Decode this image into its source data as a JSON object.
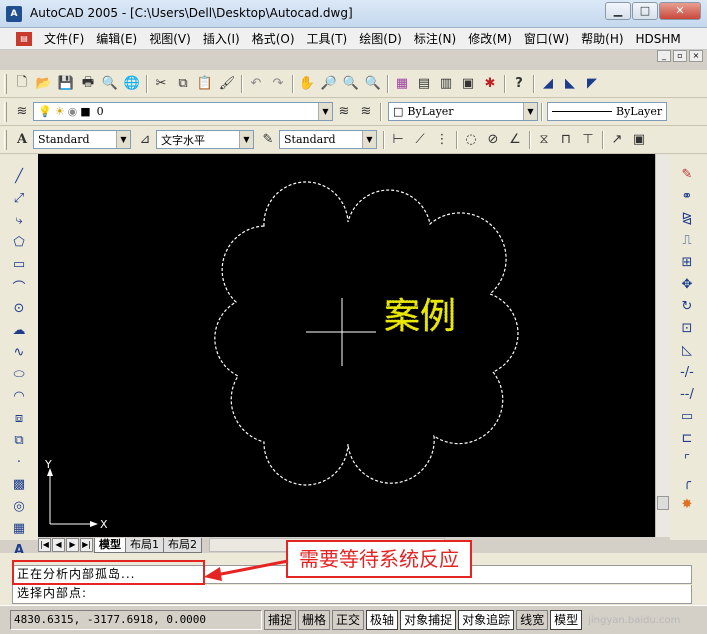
{
  "window": {
    "title": "AutoCAD 2005 - [C:\\Users\\Dell\\Desktop\\Autocad.dwg]",
    "minimize": "▁",
    "maximize": "□",
    "close": "✕"
  },
  "menu": {
    "items": [
      "文件(F)",
      "编辑(E)",
      "视图(V)",
      "插入(I)",
      "格式(O)",
      "工具(T)",
      "绘图(D)",
      "标注(N)",
      "修改(M)",
      "窗口(W)",
      "帮助(H)",
      "HDSHM"
    ]
  },
  "layer_toolbar": {
    "layer_value": "0",
    "color_value": "ByLayer",
    "linetype_value": "ByLayer"
  },
  "styles_toolbar": {
    "text_style": "Standard",
    "text_align": "文字水平",
    "dim_style": "Standard"
  },
  "drawing": {
    "text": "案例",
    "text_color": "#e8e800",
    "ucs_x_label": "X",
    "ucs_y_label": "Y"
  },
  "tabs": {
    "items": [
      "模型",
      "布局1",
      "布局2"
    ],
    "active": "模型"
  },
  "command": {
    "line1": "正在分析内部孤岛...",
    "line2": "选择内部点:"
  },
  "callout": {
    "text": "需要等待系统反应",
    "color": "#e52424"
  },
  "status": {
    "coordinates": "4830.6315, -3177.6918, 0.0000",
    "buttons": [
      "捕捉",
      "栅格",
      "正交",
      "极轴",
      "对象捕捉",
      "对象追踪",
      "线宽",
      "模型"
    ],
    "watermark": "jingyan.baidu.com"
  }
}
